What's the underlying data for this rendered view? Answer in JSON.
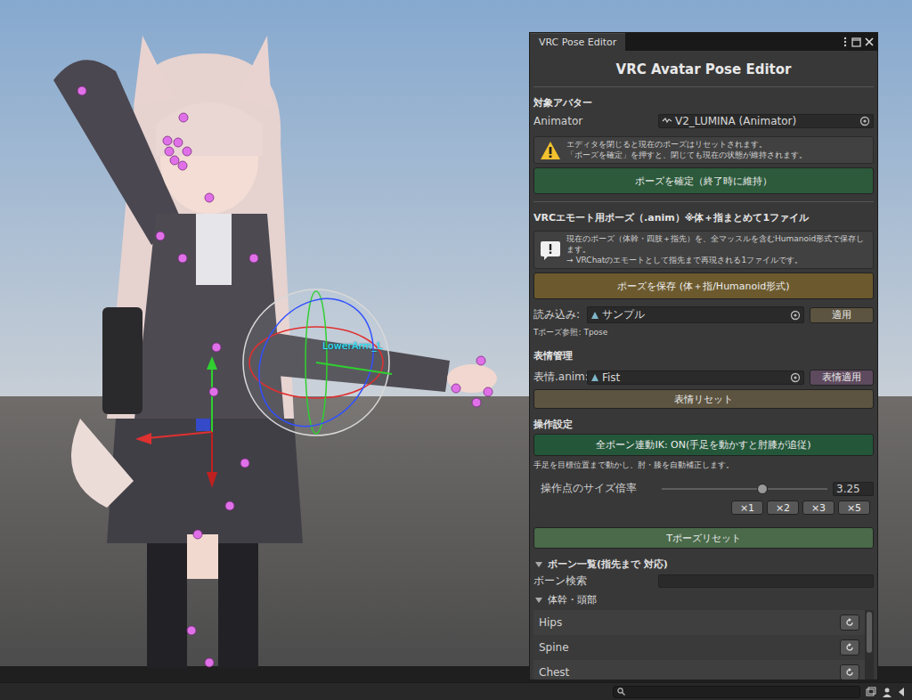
{
  "scene": {
    "gizmo_label": "LowerArm_L"
  },
  "window": {
    "title": "VRC Pose Editor"
  },
  "header": "VRC Avatar Pose Editor",
  "target": {
    "title": "対象アバター",
    "label": "Animator",
    "value": "V2_LUMINA (Animator)"
  },
  "warning": {
    "lines": [
      "エディタを閉じると現在のポーズはリセットされます。",
      "「ポーズを確定」を押すと、閉じても現在の状態が維持されます。"
    ]
  },
  "confirm_button": "ポーズを確定（終了時に維持）",
  "emote": {
    "title": "VRCエモート用ポーズ（.anim）※体＋指まとめて1ファイル",
    "info_lines": [
      "現在のポーズ（体幹・四肢＋指先）を、全マッスルを含むHumanoid形式で保存します。",
      "→ VRChatのエモートとして指先まで再現される1ファイルです。"
    ],
    "save_button": "ポーズを保存 (体＋指/Humanoid形式)",
    "load_label": "読み込み:",
    "load_value": "サンプル",
    "apply_button": "適用",
    "tpose_ref": "Tポーズ参照: Tpose"
  },
  "expression": {
    "title": "表情管理",
    "label": "表情.anim:",
    "value": "Fist",
    "apply_button": "表情適用",
    "reset_button": "表情リセット"
  },
  "controls": {
    "title": "操作設定",
    "ik_button": "全ボーン連動IK: ON(手足を動かすと肘膝が追従)",
    "ik_on": true,
    "ik_hint": "手足を目標位置まで動かし、肘・膝を自動補正します。",
    "slider_label": "操作点のサイズ倍率",
    "slider_level": 0.61,
    "slider_value": "3.25",
    "scale_buttons": [
      "×1",
      "×2",
      "×3",
      "×5"
    ],
    "tpose_reset": "Tポーズリセット"
  },
  "bones": {
    "title": "ボーン一覧(指先まで 対応)",
    "expanded": true,
    "search_label": "ボーン検索",
    "group": {
      "title": "体幹・頭部",
      "expanded": true
    },
    "rows": [
      {
        "name": "Hips"
      },
      {
        "name": "Spine"
      },
      {
        "name": "Chest"
      }
    ]
  }
}
